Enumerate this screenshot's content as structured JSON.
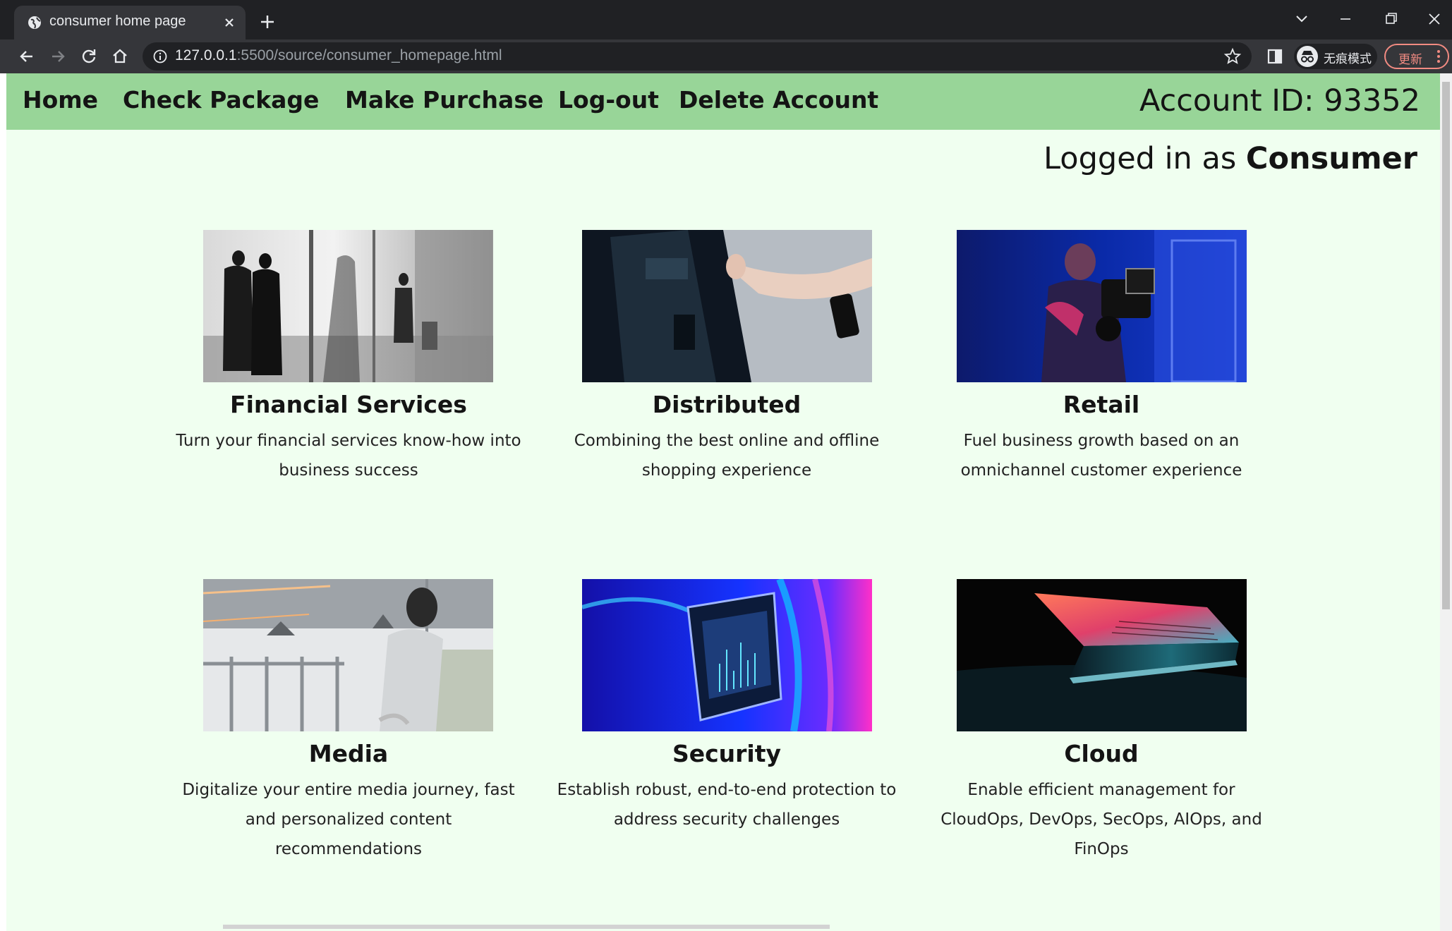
{
  "browser": {
    "tab_title": "consumer home page",
    "url_host": "127.0.0.1",
    "url_path": ":5500/source/consumer_homepage.html",
    "incognito_label": "无痕模式",
    "update_label": "更新"
  },
  "nav": {
    "links": [
      "Home",
      "Check Package",
      "Make Purchase",
      "Log-out",
      "Delete Account"
    ],
    "account_id": "Account ID: 93352"
  },
  "status": {
    "prefix": "Logged in as",
    "role": "Consumer"
  },
  "cards": [
    {
      "title": "Financial Services",
      "desc": "Turn your financial services know-how into business success"
    },
    {
      "title": "Distributed",
      "desc": "Combining the best online and offline shopping experience"
    },
    {
      "title": "Retail",
      "desc": "Fuel business growth based on an omnichannel customer experience"
    },
    {
      "title": "Media",
      "desc": "Digitalize your entire media journey, fast and personalized content recommendations"
    },
    {
      "title": "Security",
      "desc": "Establish robust, end-to-end protection to address security challenges"
    },
    {
      "title": "Cloud",
      "desc": "Enable efficient management for CloudOps, DevOps, SecOps, AIOps, and FinOps"
    }
  ],
  "colors": {
    "navbar_bg": "#98d598",
    "page_bg": "#f0fff0",
    "chrome_bg": "#202124"
  }
}
